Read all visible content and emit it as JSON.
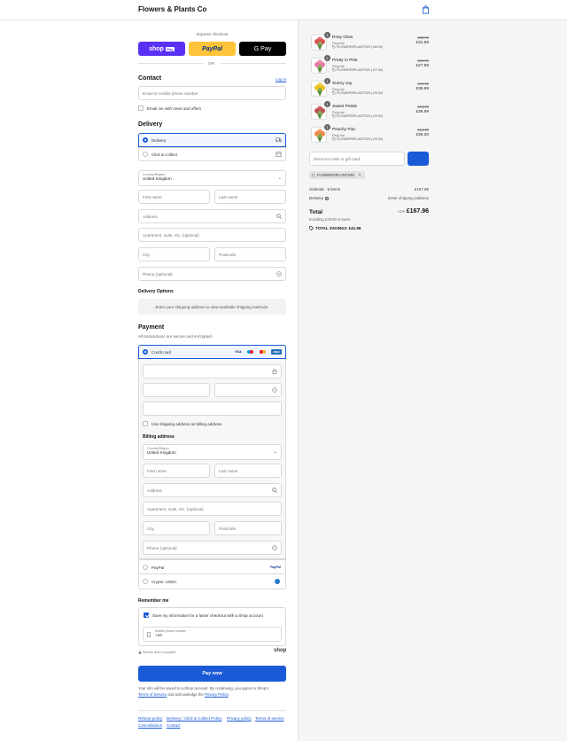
{
  "header": {
    "brand": "Flowers & Plants Co",
    "cart_icon": "shopping-bag-icon"
  },
  "express": {
    "label": "Express checkout",
    "shop_pay": "shop",
    "shop_pay_badge": "Pay",
    "paypal": "PayPal",
    "gpay": "G Pay",
    "or": "OR"
  },
  "contact": {
    "title": "Contact",
    "login": "Log in",
    "email_placeholder": "Email or mobile phone number",
    "news_label": "Email me with news and offers"
  },
  "delivery": {
    "title": "Delivery",
    "options": [
      {
        "label": "Delivery",
        "selected": true,
        "icon": "truck-icon"
      },
      {
        "label": "Click & Collect",
        "selected": false,
        "icon": "store-icon"
      }
    ],
    "country_label": "Country/Region",
    "country_value": "United Kingdom",
    "first_name": "First name",
    "last_name": "Last name",
    "address": "Address",
    "apartment": "Apartment, suite, etc. (optional)",
    "city": "City",
    "postcode": "Postcode",
    "phone": "Phone (optional)"
  },
  "delivery_options": {
    "title": "Delivery Options",
    "message": "Enter your shipping address to view available shipping methods."
  },
  "payment": {
    "title": "Payment",
    "subtitle": "All transactions are secure and encrypted.",
    "credit_card": "Credit card",
    "card_brands": [
      "VISA",
      "Maestro",
      "Mastercard",
      "AMEX"
    ],
    "use_shipping": "Use shipping address as billing address",
    "billing_title": "Billing address",
    "country_label": "Country/Region",
    "country_value": "United Kingdom",
    "first_name": "First name",
    "last_name": "Last name",
    "address": "Address",
    "apartment": "Apartment, suite, etc. (optional)",
    "city": "City",
    "postcode": "Postcode",
    "phone": "Phone (optional)",
    "paypal": "PayPal",
    "paypal_logo": "PayPal",
    "crypto": "Crypto: USDC"
  },
  "remember": {
    "title": "Remember me",
    "save_label": "Save my information for a faster checkout with a Shop account",
    "mobile_label": "Mobile phone number",
    "mobile_value": "+44",
    "secure": "Secure and encrypted",
    "shop_logo": "shop"
  },
  "pay_now": "Pay now",
  "legal": {
    "text1": "Your info will be saved to a Shop account. By continuing, you agree to Shop's",
    "terms": "Terms of Service",
    "and": " and acknowledge the ",
    "privacy": "Privacy Policy",
    "dot": "."
  },
  "footer_links": [
    "Refund policy",
    "Delivery / Click & Collect Policy",
    "Privacy policy",
    "Terms of service",
    "Cancellations",
    "Contact"
  ],
  "cart": {
    "items": [
      {
        "qty": "1",
        "name": "Rosy Glow",
        "variant": "Regular",
        "discount": "FLOWERSPLANTS25 (-£8.00)",
        "old": "£39.99",
        "price": "£31.99",
        "flower": "#d9534f"
      },
      {
        "qty": "1",
        "name": "Pretty In Pink",
        "variant": "Regular",
        "discount": "FLOWERSPLANTS25 (-£7.00)",
        "old": "£34.99",
        "price": "£27.99",
        "flower": "#e879a8"
      },
      {
        "qty": "1",
        "name": "Sunny Joy",
        "variant": "Regular",
        "discount": "FLOWERSPLANTS25 (-£9.00)",
        "old": "£44.99",
        "price": "£35.99",
        "flower": "#f0c020"
      },
      {
        "qty": "1",
        "name": "Sweet Petals",
        "variant": "Regular",
        "discount": "FLOWERSPLANTS25 (-£9.00)",
        "old": "£44.99",
        "price": "£35.99",
        "flower": "#c0504d"
      },
      {
        "qty": "1",
        "name": "Peachy Pop",
        "variant": "Regular",
        "discount": "FLOWERSPLANTS25 (-£9.00)",
        "old": "£44.99",
        "price": "£36.00",
        "flower": "#f08a4b"
      }
    ],
    "discount_placeholder": "Discount code or gift card",
    "applied_code": "FLOWERSPLANTS25",
    "subtotal_label": "Subtotal · 5 items",
    "subtotal_value": "£167.96",
    "delivery_label": "Delivery",
    "delivery_value": "Enter shipping address",
    "total_label": "Total",
    "currency": "GBP",
    "total_value": "£167.96",
    "taxes": "Including £28.00 in taxes",
    "savings_label": "TOTAL SAVINGS",
    "savings_value": "£41.96"
  }
}
